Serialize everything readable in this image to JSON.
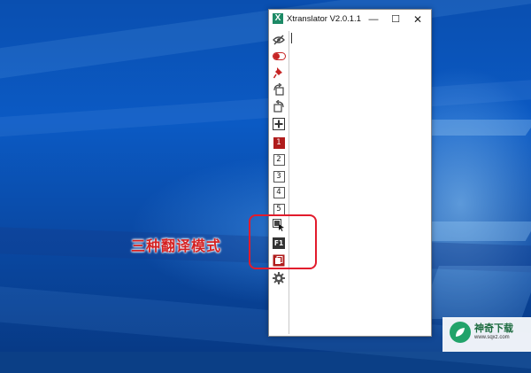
{
  "window": {
    "title": "Xtranslator V2.0.1.1",
    "logo_letter": "X",
    "controls": {
      "minimize": "—",
      "maximize": "☐",
      "close": "✕"
    }
  },
  "toolbar": {
    "icons": [
      "eye-slash-icon",
      "toggle-icon",
      "pin-icon",
      "rotate-icon",
      "rotate-reverse-icon",
      "plus-icon",
      "mode-1-icon",
      "mode-2-icon",
      "mode-3-icon",
      "mode-4-icon",
      "mode-5-icon",
      "screen-select-icon",
      "f1-hotkey-icon",
      "copy-translate-icon",
      "gear-icon"
    ],
    "mode_numbers": [
      "1",
      "2",
      "3",
      "4",
      "5"
    ],
    "active_mode": "1",
    "f1_label": "F1"
  },
  "annotation": {
    "callout_text": "三种翻译模式"
  },
  "watermark": {
    "title": "神奇下载",
    "url": "www.sqxz.com"
  },
  "colors": {
    "accent_red": "#b01c1c",
    "highlight_red": "#e21b2c",
    "logo_green": "#1d8a66"
  }
}
